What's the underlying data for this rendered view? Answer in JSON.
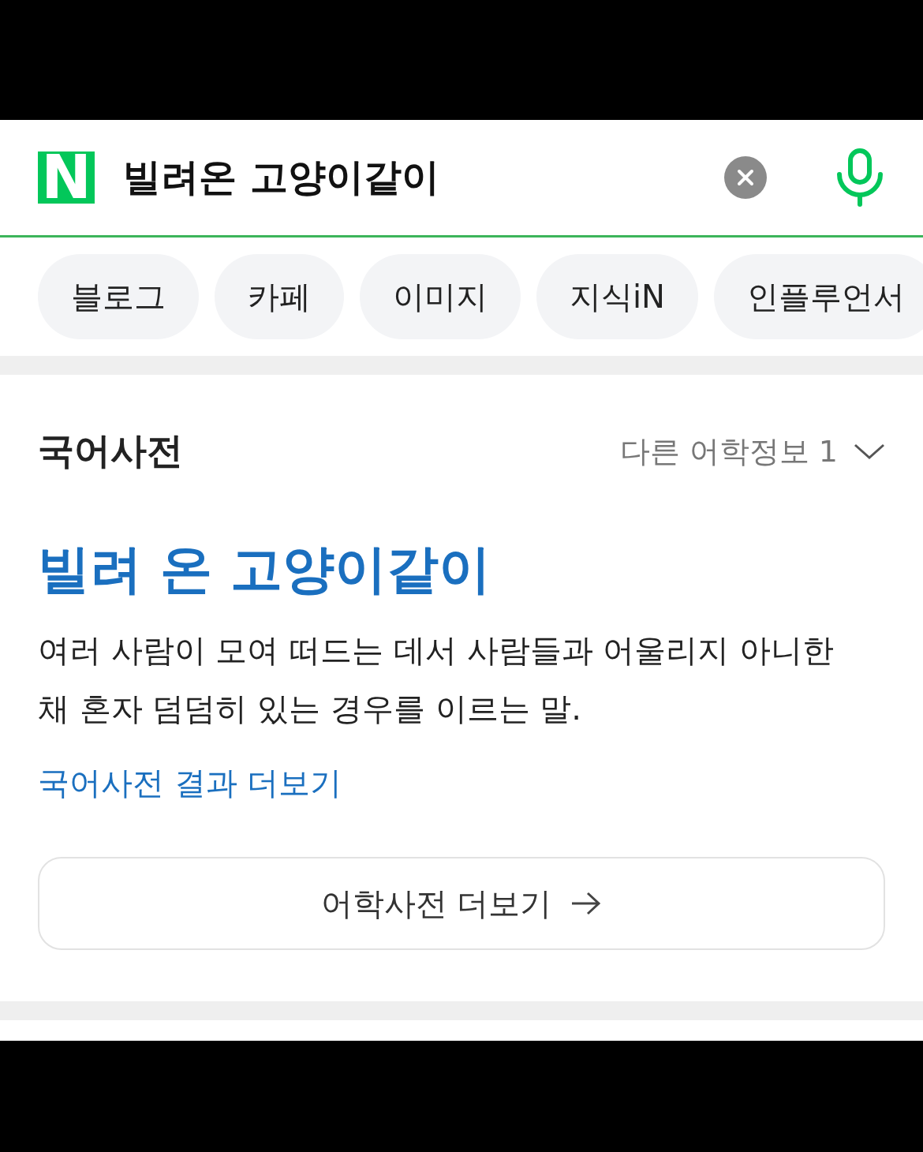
{
  "search": {
    "logo": "N",
    "value": "빌려온 고양이같이"
  },
  "tabs": [
    "블로그",
    "카페",
    "이미지",
    "지식iN",
    "인플루언서"
  ],
  "dictionary": {
    "title": "국어사전",
    "other_info": "다른 어학정보 1",
    "headword": "빌려 온 고양이같이",
    "definition": "여러 사람이 모여 떠드는 데서 사람들과 어울리지 아니한 채 혼자 덤덤히 있는 경우를 이르는 말.",
    "more_link": "국어사전 결과 더보기",
    "more_button": "어학사전 더보기"
  }
}
